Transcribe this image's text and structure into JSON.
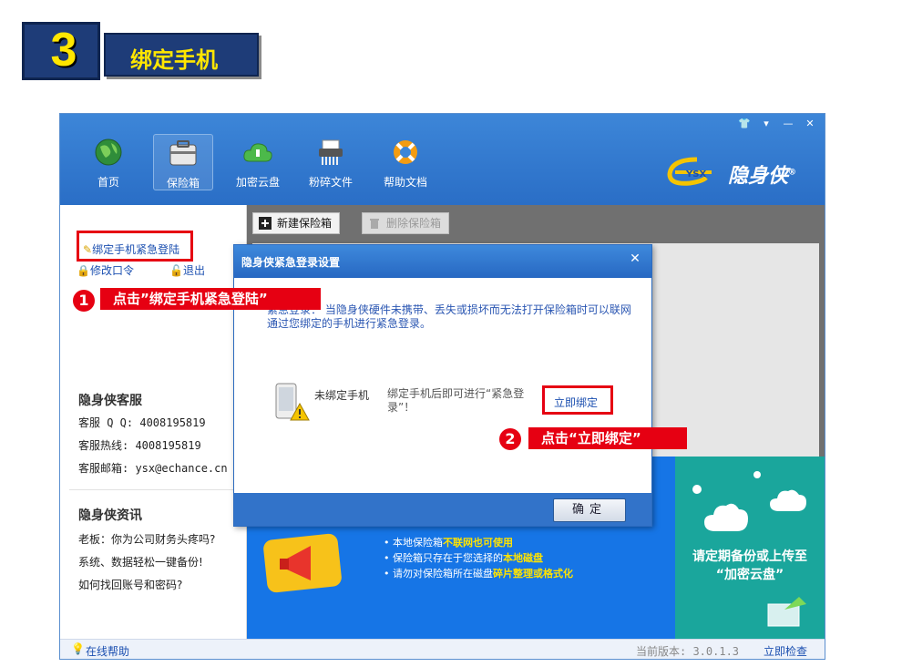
{
  "step": {
    "number": "3",
    "title": "绑定手机"
  },
  "window": {
    "controls": [
      "👕",
      "▾",
      "—",
      "✕"
    ],
    "nav": [
      {
        "label": "首页",
        "icon": "globe-icon"
      },
      {
        "label": "保险箱",
        "icon": "safe-box-icon",
        "active": true
      },
      {
        "label": "加密云盘",
        "icon": "cloud-disk-icon"
      },
      {
        "label": "粉碎文件",
        "icon": "shredder-icon"
      },
      {
        "label": "帮助文档",
        "icon": "lifebuoy-icon"
      }
    ],
    "brand": {
      "text": "隐身侠",
      "reg": "®",
      "badge": "YSX"
    }
  },
  "left_panel": {
    "bind_phone_link": "绑定手机紧急登陆",
    "change_password": "修改口令",
    "logout": "退出",
    "service_title": "隐身侠客服",
    "service_lines": [
      "客服 Q Q: 4008195819",
      "客服热线: 4008195819",
      "客服邮箱: ysx@echance.cn"
    ],
    "news_title": "隐身侠资讯",
    "news_lines": [
      "老板：你为公司财务头疼吗?",
      "系统、数据轻松一键备份!",
      "如何找回账号和密码?"
    ]
  },
  "toolbar": {
    "new_safe": "新建保险箱",
    "delete_safe": "删除保险箱"
  },
  "banner": {
    "lines": [
      {
        "prefix": "• 本地保险箱",
        "highlight": "不联网也可使用",
        "suffix": ""
      },
      {
        "prefix": "• 保险箱只存在于您选择的",
        "highlight": "本地磁盘",
        "suffix": ""
      },
      {
        "prefix": "• 请勿对保险箱所在磁盘",
        "highlight": "碎片整理或格式化",
        "suffix": ""
      }
    ],
    "right_text_1": "请定期备份或上传至",
    "right_text_2": "“加密云盘”"
  },
  "dialog": {
    "title": "隐身侠紧急登录设置",
    "close": "✕",
    "description": "紧急登录：  当隐身侠硬件未携带、丢失或损坏而无法打开保险箱时可以联网通过您绑定的手机进行紧急登录。",
    "status": "未绑定手机",
    "hint": "绑定手机后即可进行“紧急登录”！",
    "bind_button": "立即绑定",
    "ok_button": "确定"
  },
  "callouts": {
    "one_num": "1",
    "one_text": "点击”绑定手机紧急登陆”",
    "two_num": "2",
    "two_text": "点击“立即绑定”"
  },
  "statusbar": {
    "help": "在线帮助",
    "version": "当前版本: 3.0.1.3",
    "check": "立即检查"
  },
  "colors": {
    "accent_red": "#e60012",
    "title_blue": "#2a6ec6",
    "link_blue": "#1b4fb0",
    "badge_yellow": "#ffe600"
  }
}
